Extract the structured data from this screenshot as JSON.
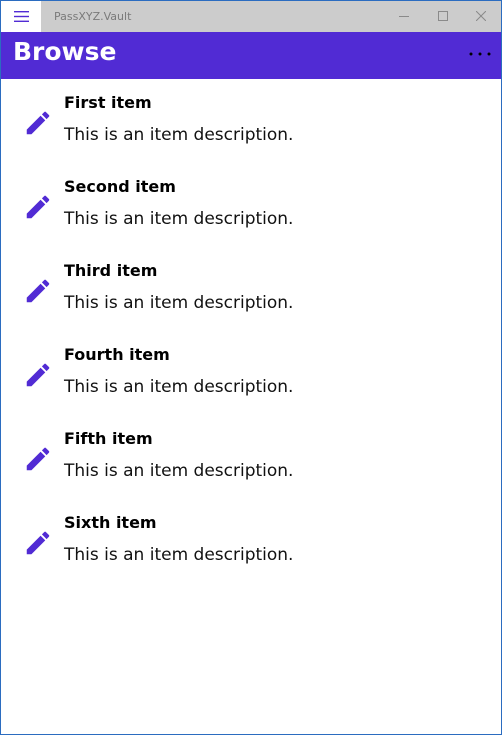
{
  "window": {
    "title": "PassXYZ.Vault",
    "titlebar_color": "#cccccc",
    "border_color": "#2b6cc0"
  },
  "icons": {
    "menu": "hamburger-menu-icon",
    "minimize": "minimize-icon",
    "maximize": "maximize-icon",
    "close": "close-icon",
    "more": "more-options-icon",
    "item": "pencil-icon"
  },
  "navbar": {
    "title": "Browse",
    "background": "#512bd4"
  },
  "accent": "#512bd4",
  "items": [
    {
      "name": "First item",
      "description": "This is an item description."
    },
    {
      "name": "Second item",
      "description": "This is an item description."
    },
    {
      "name": "Third item",
      "description": "This is an item description."
    },
    {
      "name": "Fourth item",
      "description": "This is an item description."
    },
    {
      "name": "Fifth item",
      "description": "This is an item description."
    },
    {
      "name": "Sixth item",
      "description": "This is an item description."
    }
  ]
}
